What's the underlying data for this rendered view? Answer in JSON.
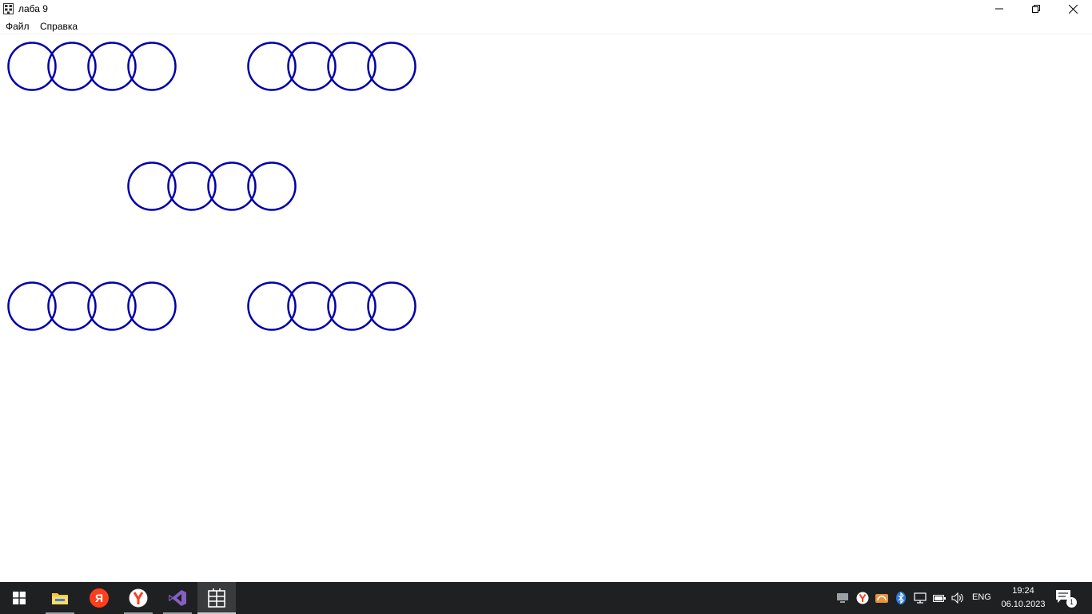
{
  "window": {
    "title": "лаба 9",
    "app_icon": "building-grid-icon"
  },
  "menu": {
    "items": [
      "Файл",
      "Справка"
    ]
  },
  "canvas": {
    "circle_color": "#0000aa",
    "background": "#ffffff"
  },
  "taskbar": {
    "background": "#1f2021",
    "apps": [
      {
        "name": "start-icon"
      },
      {
        "name": "file-explorer-icon",
        "running": true
      },
      {
        "name": "yandex-icon"
      },
      {
        "name": "yandex-browser-icon",
        "running": true
      },
      {
        "name": "visual-studio-icon",
        "running": true
      },
      {
        "name": "building-grid-icon",
        "active": true
      }
    ],
    "tray": {
      "icons": [
        "monitor-icon",
        "yandex-browser-icon",
        "disk-icon",
        "bluetooth-icon",
        "network-icon",
        "battery-icon",
        "volume-icon"
      ],
      "language": "ENG",
      "time": "19:24",
      "date": "06.10.2023",
      "notification_count": "1"
    }
  }
}
